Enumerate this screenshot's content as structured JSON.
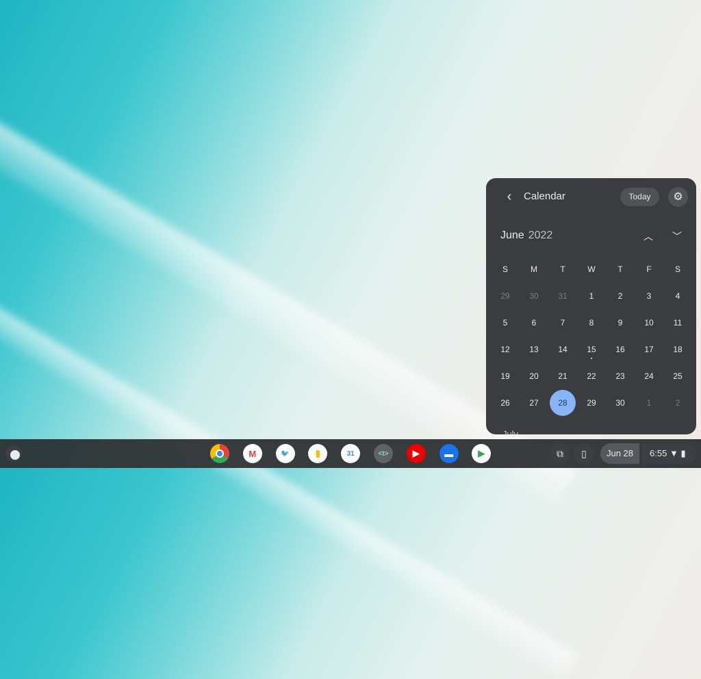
{
  "calendar": {
    "title": "Calendar",
    "today_label": "Today",
    "month": "June",
    "year": "2022",
    "next_month_label": "July",
    "weekdays": [
      "S",
      "M",
      "T",
      "W",
      "T",
      "F",
      "S"
    ],
    "weeks": [
      [
        "29",
        "30",
        "31",
        "1",
        "2",
        "3",
        "4"
      ],
      [
        "5",
        "6",
        "7",
        "8",
        "9",
        "10",
        "11"
      ],
      [
        "12",
        "13",
        "14",
        "15",
        "16",
        "17",
        "18"
      ],
      [
        "19",
        "20",
        "21",
        "22",
        "23",
        "24",
        "25"
      ],
      [
        "26",
        "27",
        "28",
        "29",
        "30",
        "1",
        "2"
      ]
    ],
    "selected_day": "28",
    "event_day": "15"
  },
  "shelf": {
    "apps": [
      "Chrome",
      "Gmail",
      "Twitter",
      "Keep",
      "Google Calendar",
      "Text",
      "YouTube Music",
      "Files",
      "Play Store"
    ],
    "date": "Jun 28",
    "time": "6:55"
  },
  "colors": {
    "panel": "#3b3c3f",
    "accent": "#8ab4f8"
  }
}
